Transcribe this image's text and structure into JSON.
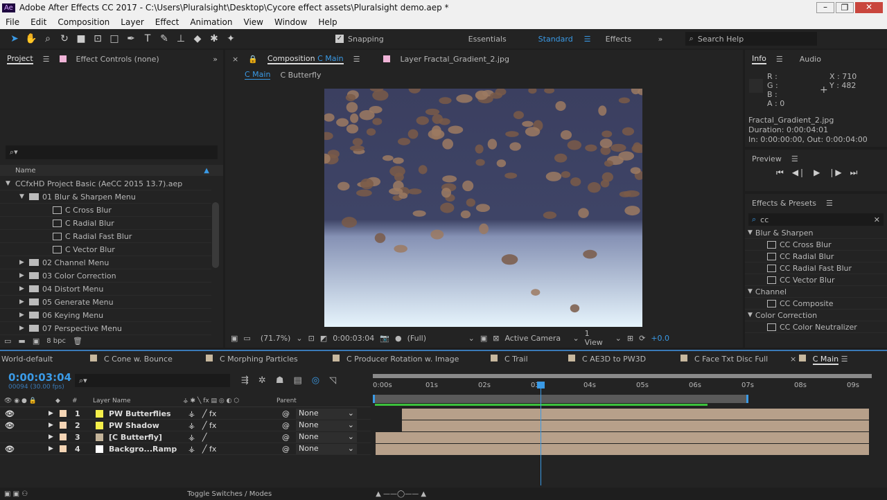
{
  "window": {
    "title": "Adobe After Effects CC 2017 - C:\\Users\\Pluralsight\\Desktop\\Cycore effect assets\\Pluralsight demo.aep *",
    "icon": "Ae"
  },
  "menu": [
    "File",
    "Edit",
    "Composition",
    "Layer",
    "Effect",
    "Animation",
    "View",
    "Window",
    "Help"
  ],
  "toolbar": {
    "snapping": "Snapping",
    "workspaces": [
      "Essentials",
      "Standard",
      "Effects"
    ],
    "active_workspace": "Standard",
    "search_help": "Search Help"
  },
  "project": {
    "tab": "Project",
    "tab2": "Effect Controls (none)",
    "column": "Name",
    "bpc": "8 bpc",
    "items": [
      {
        "label": "CCfxHD Project Basic (AeCC 2015 13.7).aep",
        "level": 0,
        "type": "root"
      },
      {
        "label": "01 Blur & Sharpen Menu",
        "level": 1,
        "type": "folder-open"
      },
      {
        "label": "C Cross Blur",
        "level": 2,
        "type": "comp"
      },
      {
        "label": "C Radial Blur",
        "level": 2,
        "type": "comp"
      },
      {
        "label": "C Radial Fast Blur",
        "level": 2,
        "type": "comp"
      },
      {
        "label": "C Vector Blur",
        "level": 2,
        "type": "comp"
      },
      {
        "label": "02 Channel Menu",
        "level": 1,
        "type": "folder"
      },
      {
        "label": "03 Color Correction",
        "level": 1,
        "type": "folder"
      },
      {
        "label": "04 Distort Menu",
        "level": 1,
        "type": "folder"
      },
      {
        "label": "05 Generate Menu",
        "level": 1,
        "type": "folder"
      },
      {
        "label": "06 Keying Menu",
        "level": 1,
        "type": "folder"
      },
      {
        "label": "07 Perspective Menu",
        "level": 1,
        "type": "folder"
      }
    ]
  },
  "viewer": {
    "tab_prefix": "Composition",
    "tab_comp": "C Main",
    "tab2": "Layer  Fractal_Gradient_2.jpg",
    "crumbs": [
      "C Main",
      "C Butterfly"
    ],
    "zoom": "(71.7%)",
    "time": "0:00:03:04",
    "resolution": "(Full)",
    "camera": "Active Camera",
    "views": "1 View",
    "exposure": "+0.0"
  },
  "info": {
    "tab": "Info",
    "tab2": "Audio",
    "r": "R :",
    "g": "G :",
    "b": "B :",
    "a": "A : 0",
    "x": "X : 710",
    "y": "Y : 482",
    "file": "Fractal_Gradient_2.jpg",
    "duration": "Duration: 0:00:04:01",
    "inout": "In: 0:00:00:00, Out: 0:00:04:00"
  },
  "preview": {
    "title": "Preview"
  },
  "effects": {
    "title": "Effects & Presets",
    "search": "cc",
    "items": [
      {
        "label": "Blur & Sharpen",
        "cat": true
      },
      {
        "label": "CC Cross Blur"
      },
      {
        "label": "CC Radial Blur"
      },
      {
        "label": "CC Radial Fast Blur"
      },
      {
        "label": "CC Vector Blur"
      },
      {
        "label": "Channel",
        "cat": true
      },
      {
        "label": "CC Composite"
      },
      {
        "label": "Color Correction",
        "cat": true
      },
      {
        "label": "CC Color Neutralizer"
      }
    ]
  },
  "timeline": {
    "tabs": [
      "World-default",
      "C Cone w. Bounce",
      "C Morphing Particles",
      "C Producer Rotation w. Image",
      "C Trail",
      "C AE3D to PW3D",
      "C Face Txt Disc Full",
      "C Main"
    ],
    "active_tab": "C Main",
    "timecode": "0:00:03:04",
    "frames": "00094 (30.00 fps)",
    "col_num": "#",
    "col_name": "Layer Name",
    "col_parent": "Parent",
    "ticks": [
      "0:00s",
      "01s",
      "02s",
      "03s",
      "04s",
      "05s",
      "06s",
      "07s",
      "08s",
      "09s"
    ],
    "layers": [
      {
        "num": "1",
        "name": "PW Butterflies",
        "color": "#f5ef4a",
        "fx": true,
        "parent": "None",
        "visible": true
      },
      {
        "num": "2",
        "name": "PW Shadow",
        "color": "#f5ef4a",
        "fx": true,
        "parent": "None",
        "visible": true
      },
      {
        "num": "3",
        "name": "[C Butterfly]",
        "color": "#c4b49a",
        "fx": false,
        "parent": "None",
        "visible": false
      },
      {
        "num": "4",
        "name": "Backgro...Ramp",
        "color": "#ffffff",
        "fx": true,
        "parent": "None",
        "visible": true
      }
    ],
    "toggle": "Toggle Switches / Modes"
  },
  "colors": {
    "accent": "#3a9ae6",
    "bar": "#b7a08a"
  }
}
